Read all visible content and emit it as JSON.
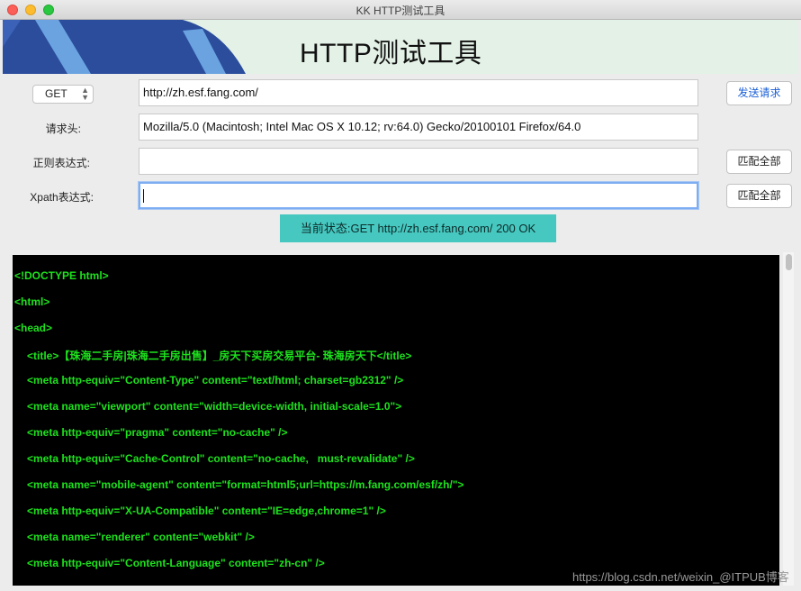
{
  "window": {
    "title": "KK HTTP测试工具"
  },
  "banner": {
    "title": "HTTP测试工具"
  },
  "request": {
    "method": "GET",
    "url": "http://zh.esf.fang.com/",
    "send_label": "发送请求"
  },
  "headers": {
    "label": "请求头:",
    "value": "Mozilla/5.0 (Macintosh; Intel Mac OS X 10.12; rv:64.0) Gecko/20100101 Firefox/64.0"
  },
  "regex": {
    "label": "正则表达式:",
    "value": "",
    "match_label": "匹配全部"
  },
  "xpath": {
    "label": "Xpath表达式:",
    "value": "",
    "match_label": "匹配全部"
  },
  "status": {
    "text": "当前状态:GET http://zh.esf.fang.com/    200 OK"
  },
  "output": {
    "lines": [
      "<!DOCTYPE html>",
      "<html>",
      "<head>",
      "<title>【珠海二手房|珠海二手房出售】_房天下买房交易平台- 珠海房天下</title>",
      "<meta http-equiv=\"Content-Type\" content=\"text/html; charset=gb2312\" />",
      "<meta name=\"viewport\" content=\"width=device-width, initial-scale=1.0\">",
      "<meta http-equiv=\"pragma\" content=\"no-cache\" />",
      "<meta http-equiv=\"Cache-Control\" content=\"no-cache,   must-revalidate\" />",
      "<meta name=\"mobile-agent\" content=\"format=html5;url=https://m.fang.com/esf/zh/\">",
      "<meta http-equiv=\"X-UA-Compatible\" content=\"IE=edge,chrome=1\" />",
      "<meta name=\"renderer\" content=\"webkit\" />",
      "<meta http-equiv=\"Content-Language\" content=\"zh-cn\" />"
    ]
  },
  "watermark": {
    "text": "https://blog.csdn.net/weixin_@ITPUB博客"
  },
  "colors": {
    "status_bg": "#46c8c0",
    "output_bg": "#000000",
    "output_text": "#1de21d",
    "banner_bg": "#e3f1e6",
    "accent": "#1a5fd6"
  }
}
